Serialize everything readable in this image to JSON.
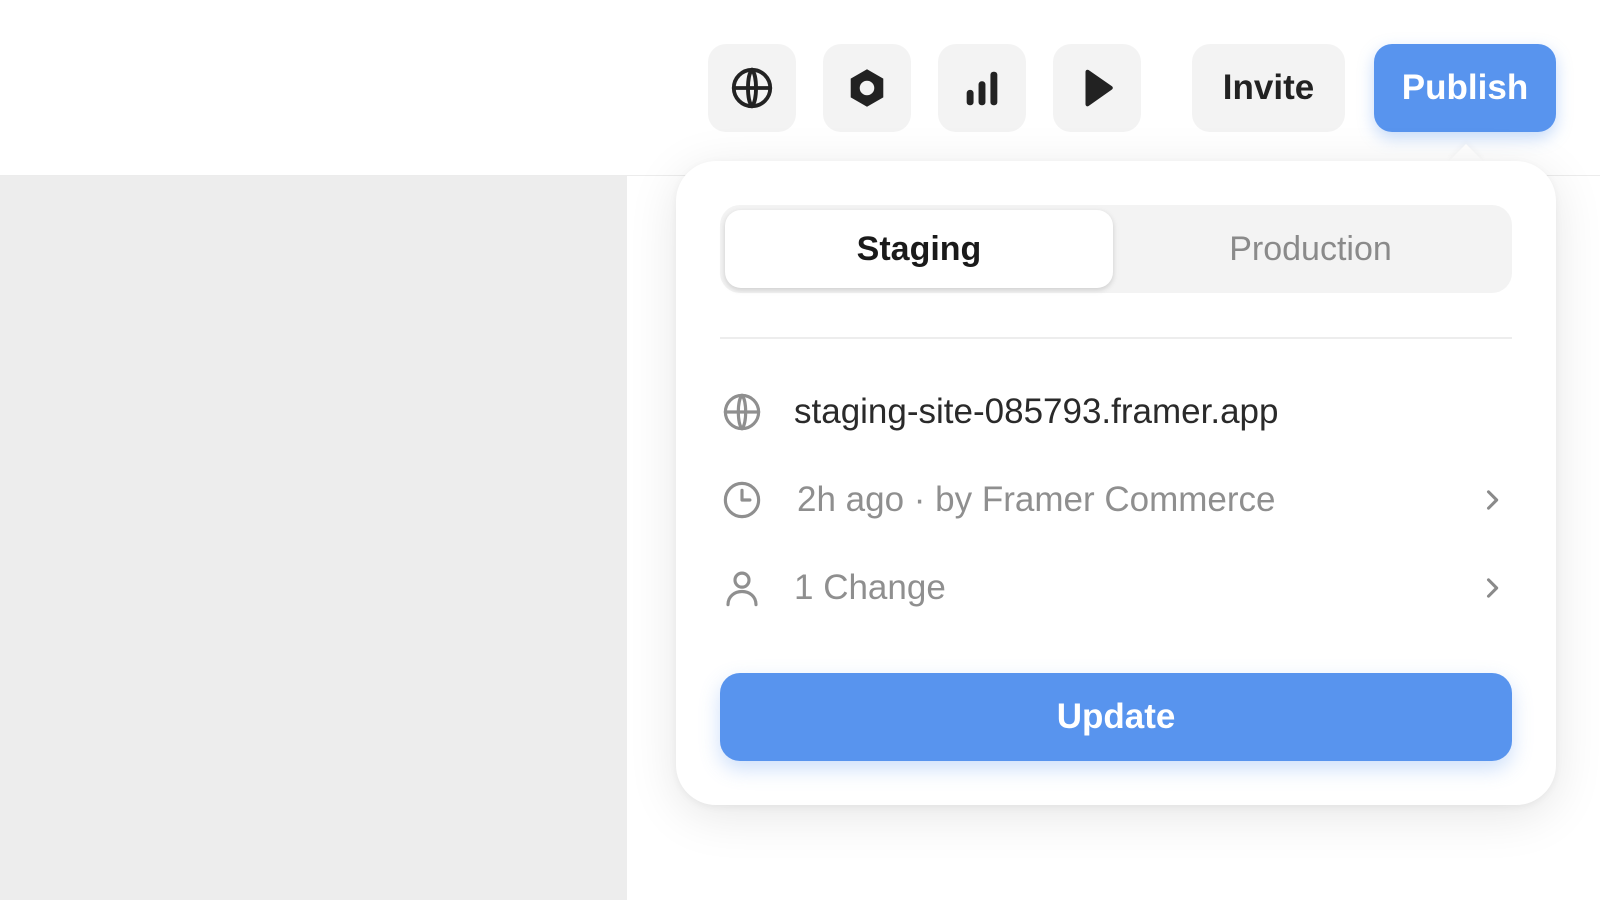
{
  "colors": {
    "accent": "#5894ee",
    "icon_dark": "#222222",
    "icon_muted": "#8f8f8f"
  },
  "toolbar": {
    "icons": [
      "globe-icon",
      "hexagon-icon",
      "bar-chart-icon",
      "play-icon"
    ],
    "invite_label": "Invite",
    "publish_label": "Publish"
  },
  "publish_popover": {
    "tabs": [
      {
        "label": "Staging",
        "selected": true
      },
      {
        "label": "Production",
        "selected": false
      }
    ],
    "details": {
      "url": "staging-site-085793.framer.app",
      "last_published": "2h ago · by Framer Commerce",
      "changes": "1 Change"
    },
    "update_label": "Update"
  }
}
